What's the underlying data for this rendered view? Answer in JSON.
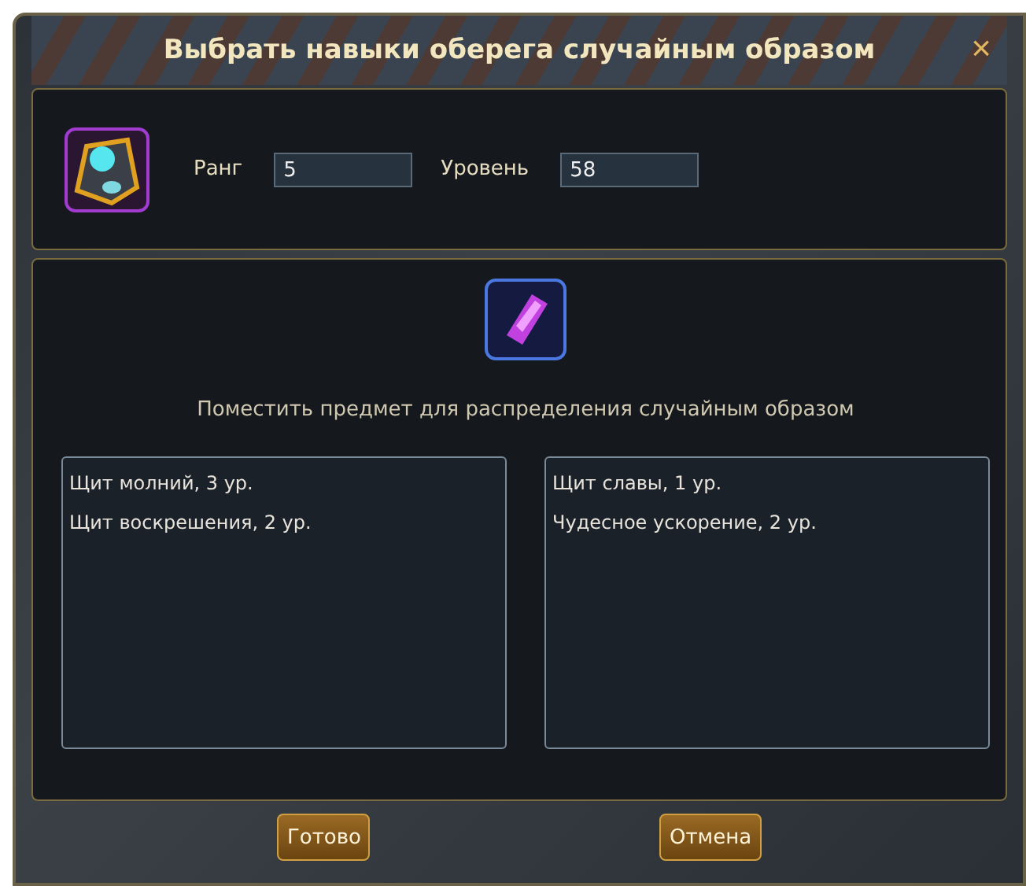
{
  "window": {
    "title": "Выбрать навыки оберега случайным образом",
    "close": "×"
  },
  "info": {
    "fields": [
      {
        "label": "Ранг",
        "value": "5"
      },
      {
        "label": "Уровень",
        "value": "58"
      }
    ]
  },
  "placement": {
    "hint": "Поместить предмет для распределения случайным образом"
  },
  "lists": [
    {
      "items": [
        "Щит молний, 3 ур.",
        "Щит воскрешения, 2 ур."
      ]
    },
    {
      "items": [
        "Щит славы, 1 ур.",
        "Чудесное ускорение, 2 ур."
      ]
    }
  ],
  "buttons": [
    "Готово",
    "Отмена"
  ]
}
